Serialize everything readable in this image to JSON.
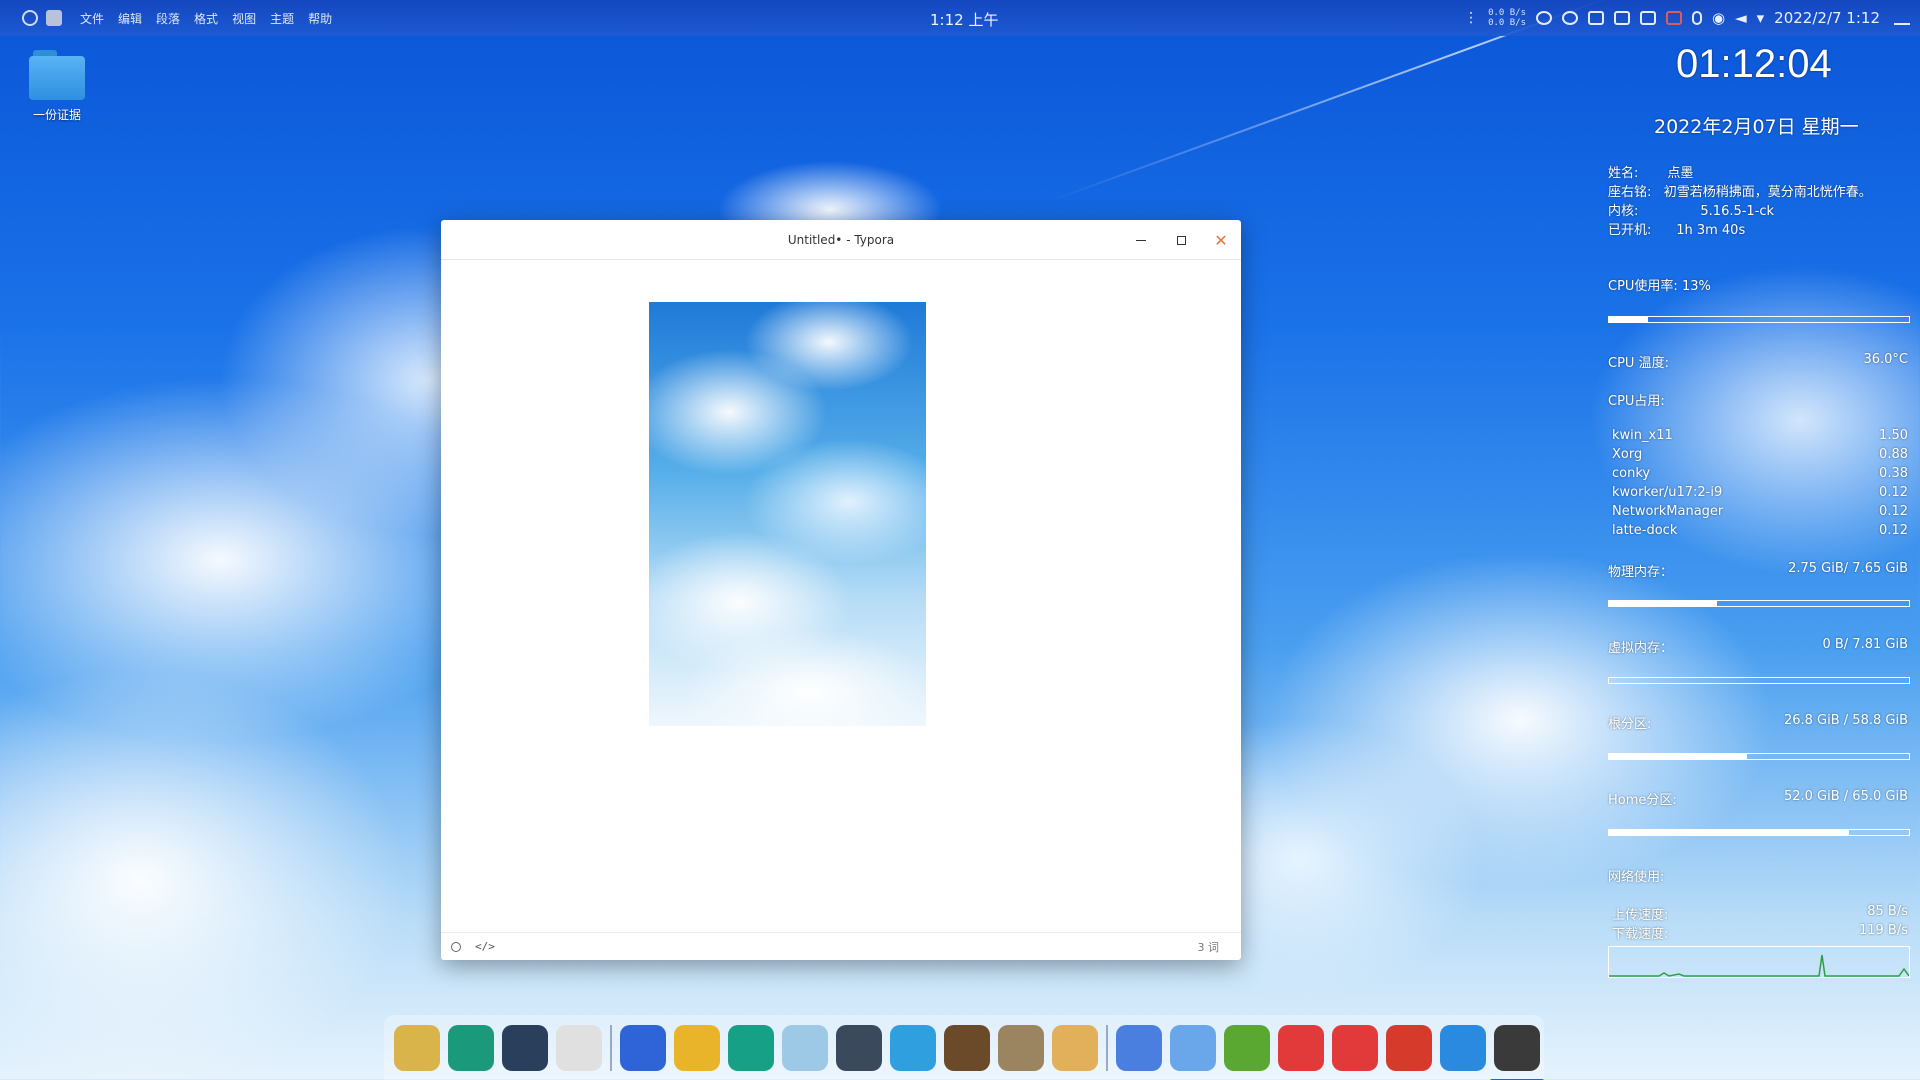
{
  "top_panel": {
    "menu": [
      "文件",
      "编辑",
      "段落",
      "格式",
      "视图",
      "主题",
      "帮助"
    ],
    "clock": "1:12 上午",
    "net_up": "0.0 B/s",
    "net_down": "0.0 B/s",
    "datetime": "2022/2/7   1:12"
  },
  "desktop": {
    "icon_label": "一份证据"
  },
  "conky": {
    "time": "01:12:04",
    "date": "2022年2月07日 星期一",
    "name_k": "姓名:",
    "name_v": "点墨",
    "motto_k": "座右铭:",
    "motto_v": "初雪若杨稍拂面，莫分南北恍作春。",
    "kernel_k": "内核:",
    "kernel_v": "5.16.5-1-ck",
    "uptime_k": "已开机:",
    "uptime_v": "1h 3m 40s",
    "cpu_usage": "CPU使用率: 13%",
    "cpu_usage_pct": 13,
    "cpu_temp_k": "CPU 温度:",
    "cpu_temp_v": "36.0°C",
    "cpu_top_title": "CPU占用:",
    "processes": [
      {
        "name": "kwin_x11",
        "value": "1.50"
      },
      {
        "name": "Xorg",
        "value": "0.88"
      },
      {
        "name": "conky",
        "value": "0.38"
      },
      {
        "name": "kworker/u17:2-i9",
        "value": "0.12"
      },
      {
        "name": "NetworkManager",
        "value": "0.12"
      },
      {
        "name": "latte-dock",
        "value": "0.12"
      }
    ],
    "mem_k": "物理内存：",
    "mem_v": "2.75 GiB/ 7.65 GiB",
    "mem_pct": 36,
    "swap_k": "虚拟内存：",
    "swap_v": "0 B/ 7.81 GiB",
    "swap_pct": 0,
    "root_k": "根分区:",
    "root_v": "26.8 GiB / 58.8 GiB",
    "root_pct": 46,
    "home_k": "Home分区:",
    "home_v": "52.0 GiB / 65.0 GiB",
    "home_pct": 80,
    "net_title": "网络使用:",
    "up_k": "上传速度:",
    "up_v": "85 B/s",
    "down_k": "下载速度:",
    "down_v": "119 B/s"
  },
  "window": {
    "title": "Untitled• - Typora",
    "word_count": "3 词",
    "source_toggle": "</>"
  },
  "dock": {
    "items": [
      {
        "name": "file-manager",
        "color": "#d9b44a"
      },
      {
        "name": "system-settings",
        "color": "#1a9a7a"
      },
      {
        "name": "dashboard",
        "color": "#2a3f5c"
      },
      {
        "name": "kde-connect",
        "color": "#e0e0e0"
      },
      {
        "name": "wps-office",
        "color": "#2f63d8"
      },
      {
        "name": "google-chrome",
        "color": "#e9b42a"
      },
      {
        "name": "notes",
        "color": "#16a085"
      },
      {
        "name": "wechat",
        "color": "#9ec9e6"
      },
      {
        "name": "electron-app",
        "color": "#3a4a5c"
      },
      {
        "name": "telegram",
        "color": "#2f9fe0"
      },
      {
        "name": "minecraft",
        "color": "#6b4a2a"
      },
      {
        "name": "gimp",
        "color": "#9a8560"
      },
      {
        "name": "go-game",
        "color": "#e2b05a"
      },
      {
        "name": "font-viewer",
        "color": "#4a7fe0"
      },
      {
        "name": "baidu-netdisk",
        "color": "#6aa7ea"
      },
      {
        "name": "android-studio",
        "color": "#5aa832"
      },
      {
        "name": "xmind",
        "color": "#e23a3a"
      },
      {
        "name": "netease-music",
        "color": "#e23a3a"
      },
      {
        "name": "filezilla",
        "color": "#d63a2a"
      },
      {
        "name": "vscode",
        "color": "#2a8ae0"
      },
      {
        "name": "typora",
        "color": "#3a3a3a"
      }
    ]
  }
}
